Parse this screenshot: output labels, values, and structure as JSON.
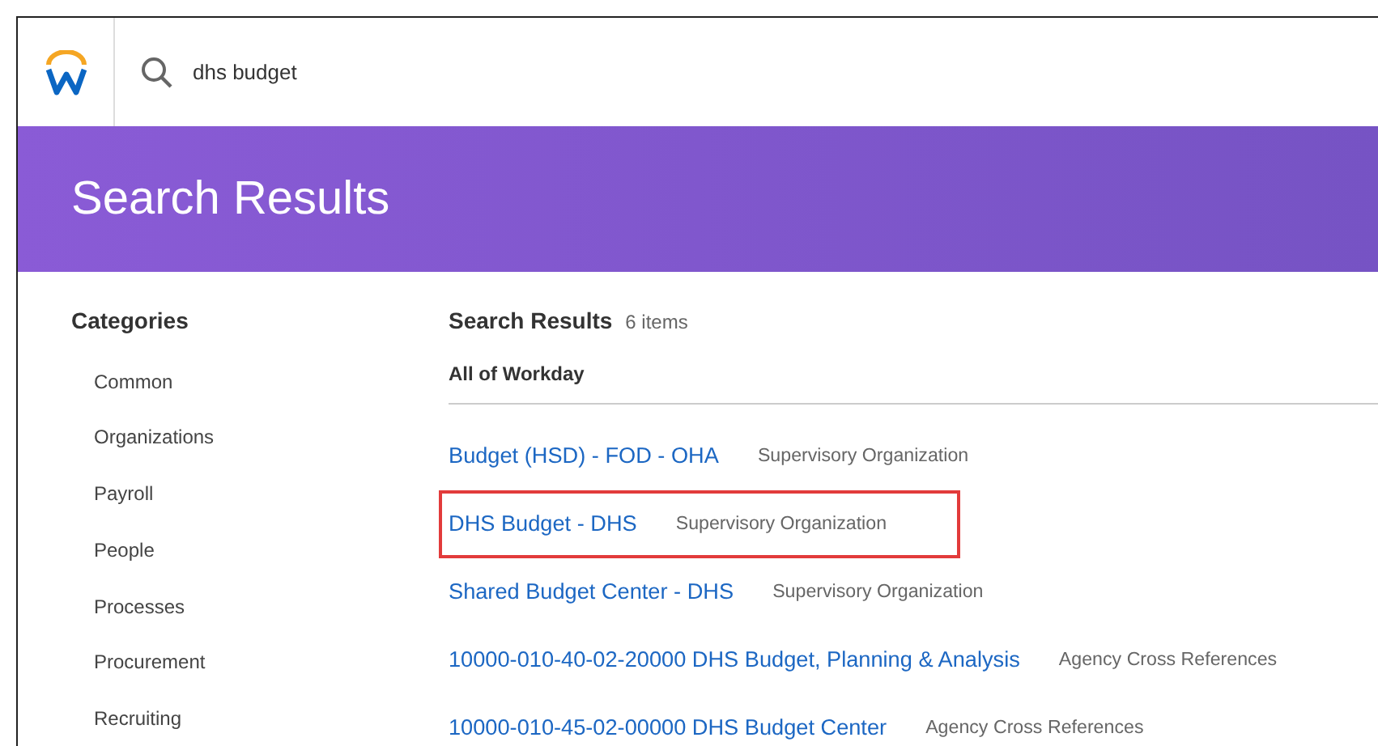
{
  "search": {
    "value": "dhs budget"
  },
  "banner": {
    "title": "Search Results"
  },
  "categories": {
    "heading": "Categories",
    "items": [
      {
        "label": "Common"
      },
      {
        "label": "Organizations"
      },
      {
        "label": "Payroll"
      },
      {
        "label": "People"
      },
      {
        "label": "Processes"
      },
      {
        "label": "Procurement"
      },
      {
        "label": "Recruiting"
      }
    ]
  },
  "results": {
    "heading": "Search Results",
    "count": "6 items",
    "scope": "All of Workday",
    "items": [
      {
        "title": "Budget (HSD) - FOD - OHA",
        "type": "Supervisory Organization",
        "highlighted": false
      },
      {
        "title": "DHS Budget - DHS",
        "type": "Supervisory Organization",
        "highlighted": true
      },
      {
        "title": "Shared Budget Center - DHS",
        "type": "Supervisory Organization",
        "highlighted": false
      },
      {
        "title": "10000-010-40-02-20000 DHS Budget, Planning & Analysis",
        "type": "Agency Cross References",
        "highlighted": false
      },
      {
        "title": "10000-010-45-02-00000 DHS Budget Center",
        "type": "Agency Cross References",
        "highlighted": false
      }
    ]
  }
}
